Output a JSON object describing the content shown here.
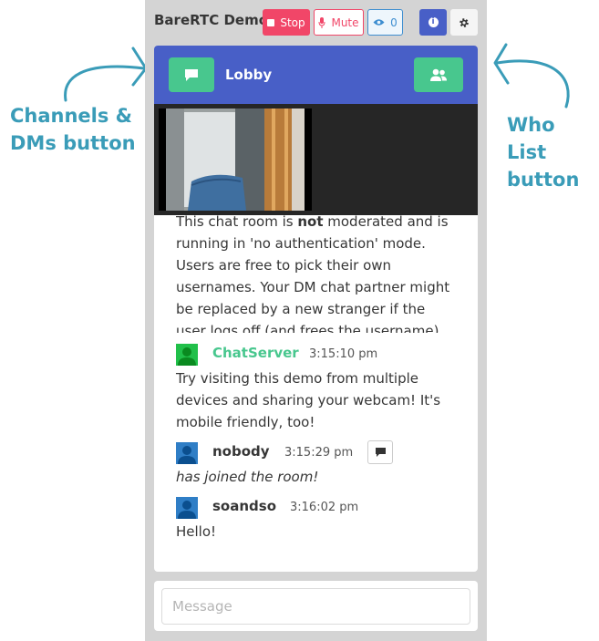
{
  "annotations": {
    "left_label_line1": "Channels &",
    "left_label_line2": "DMs button",
    "right_label_line1": "Who List",
    "right_label_line2": "button"
  },
  "topbar": {
    "title": "BareRTC Demo",
    "stop_label": "Stop",
    "mute_label": "Mute",
    "watchers_count": "0",
    "info_icon": "i"
  },
  "channel": {
    "name": "Lobby"
  },
  "messages": {
    "intro_part1": "This chat room is ",
    "intro_bold": "not",
    "intro_part2": " moderated and is running in 'no authentication' mode. Users are free to pick their own usernames. Your DM chat partner might be replaced by a new stranger if the user logs off (and frees the username) and somebody else logs in!",
    "items": [
      {
        "user": "ChatServer",
        "time": "3:15:10 pm",
        "text": "Try visiting this demo from multiple devices and sharing your webcam! It's mobile friendly, too!"
      },
      {
        "user": "nobody",
        "time": "3:15:29 pm",
        "text": "has joined the room!"
      },
      {
        "user": "soandso",
        "time": "3:16:02 pm",
        "text": "Hello!"
      }
    ]
  },
  "composer": {
    "placeholder": "Message",
    "value": ""
  },
  "icons": {
    "stop": "stop-square-icon",
    "mute": "microphone-icon",
    "watchers": "eye-icon",
    "info": "info-icon",
    "settings": "gear-icon",
    "channels": "chat-bubble-icon",
    "who_list": "users-icon",
    "dm": "comment-icon",
    "avatar": "user-silhouette-icon"
  },
  "colors": {
    "header": "#485fc7",
    "accent_green": "#48c78e",
    "danger": "#f14668",
    "annotation": "#3a9cb8"
  }
}
